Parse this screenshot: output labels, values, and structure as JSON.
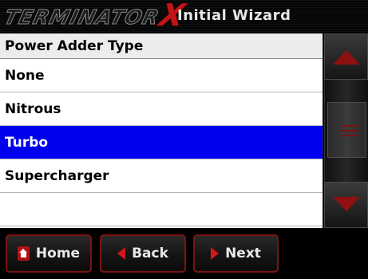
{
  "header": {
    "brand_word": "TERMINATOR",
    "brand_x": "X",
    "title": "Initial Wizard"
  },
  "list": {
    "header": "Power Adder Type",
    "items": [
      {
        "label": "None"
      },
      {
        "label": "Nitrous"
      },
      {
        "label": "Turbo"
      },
      {
        "label": "Supercharger"
      },
      {
        "label": ""
      }
    ],
    "selected": "Turbo"
  },
  "buttons": {
    "home": "Home",
    "back": "Back",
    "next": "Next"
  },
  "colors": {
    "accent": "#7a1414",
    "selection": "#0000f0",
    "brand_red": "#c41414"
  },
  "icons": {
    "home": "home-icon",
    "back": "arrow-left-icon",
    "next": "arrow-right-icon",
    "scroll_up": "scroll-up-icon",
    "scroll_down": "scroll-down-icon"
  }
}
